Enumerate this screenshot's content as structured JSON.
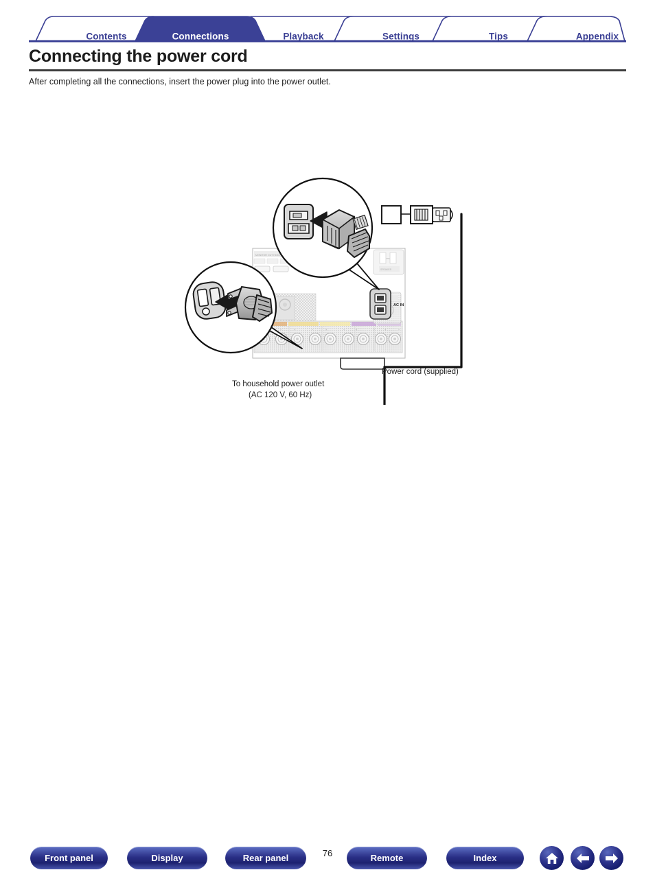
{
  "tabs": [
    {
      "label": "Contents",
      "active": false
    },
    {
      "label": "Connections",
      "active": true
    },
    {
      "label": "Playback",
      "active": false
    },
    {
      "label": "Settings",
      "active": false
    },
    {
      "label": "Tips",
      "active": false
    },
    {
      "label": "Appendix",
      "active": false
    }
  ],
  "heading": {
    "title": "Connecting the power cord",
    "intro": "After completing all the connections, insert the power plug into the power outlet."
  },
  "diagram": {
    "ac_inlet_label": "AC IN",
    "captions": {
      "outlet_line1": "To household power outlet",
      "outlet_line2": "(AC 120 V, 60 Hz)",
      "power_cord": "Power cord (supplied)"
    }
  },
  "footer": {
    "buttons": [
      {
        "label": "Front panel"
      },
      {
        "label": "Display"
      },
      {
        "label": "Rear panel"
      },
      {
        "label": "Remote"
      },
      {
        "label": "Index"
      }
    ],
    "page_number": "76",
    "icons": [
      {
        "name": "home-icon"
      },
      {
        "name": "arrow-left-icon"
      },
      {
        "name": "arrow-right-icon"
      }
    ]
  },
  "colors": {
    "brand_blue": "#3a3f94",
    "active_tab_fill": "#3b4196",
    "rule_dark": "#3d3d3d",
    "text": "#1f1f1f"
  }
}
